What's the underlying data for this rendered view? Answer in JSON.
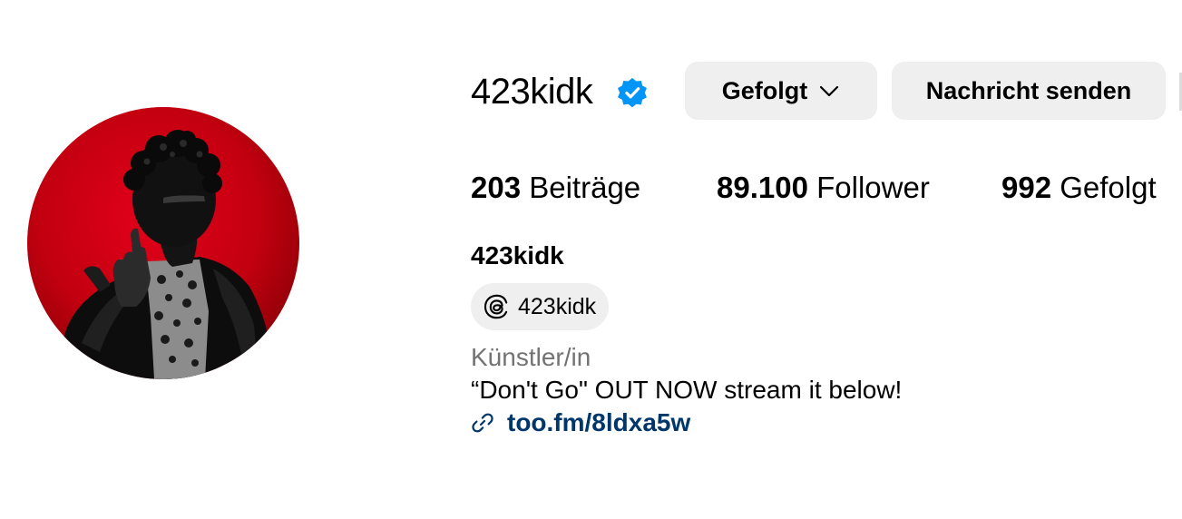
{
  "profile": {
    "username": "423kidk",
    "verified": true,
    "avatar_description": "profile-photo",
    "accent_color": "#0095f6",
    "avatar_bg_color": "#d40012"
  },
  "actions": {
    "follow_label": "Gefolgt",
    "message_label": "Nachricht senden"
  },
  "stats": {
    "posts_count": "203",
    "posts_label": "Beiträge",
    "followers_count": "89.100",
    "followers_label": "Follower",
    "following_count": "992",
    "following_label": "Gefolgt"
  },
  "bio": {
    "display_name": "423kidk",
    "threads_handle": "423kidk",
    "category": "Künstler/in",
    "text": "“Don't Go\" OUT NOW stream it below!",
    "link": "too.fm/8ldxa5w",
    "link_color": "#00376b"
  },
  "icons": {
    "verified": "verified-badge-icon",
    "chevron": "chevron-down-icon",
    "threads": "threads-icon",
    "link": "link-icon"
  }
}
